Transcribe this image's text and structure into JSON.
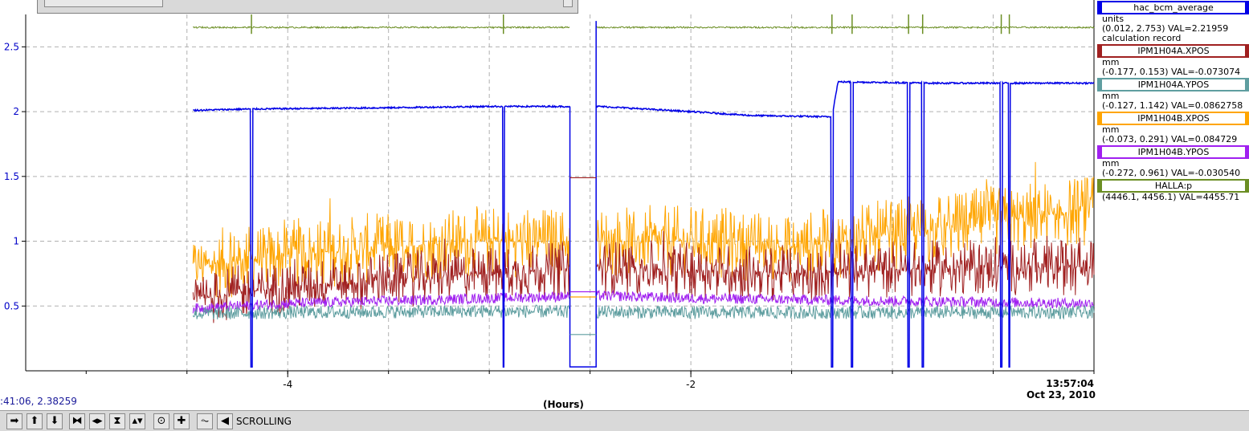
{
  "chart_data": {
    "type": "line",
    "title": "",
    "xlabel": "(Hours)",
    "ylabel": "",
    "xlim": [
      -5.3,
      0.0
    ],
    "ylim": [
      0.0,
      2.75
    ],
    "x_ticks": [
      -4,
      -2
    ],
    "x_tick_labels": [
      "-4",
      "-2"
    ],
    "y_ticks": [
      0.5,
      1,
      1.5,
      2,
      2.5
    ],
    "y_tick_labels": [
      "0.5",
      "1",
      "1.5",
      "2",
      "2.5"
    ],
    "grid": true,
    "legend_position": "right",
    "end_time": "13:57:04",
    "end_date": "Oct 23, 2010",
    "series": [
      {
        "name": "hac_bcm_average",
        "units": "units",
        "range": "(0.012, 2.753)",
        "value": "VAL=2.21959",
        "extra": "calculation record",
        "color": "#0000e6",
        "profile": [
          [
            -4.47,
            2.01
          ],
          [
            -4.2,
            2.02
          ],
          [
            -3.5,
            2.03
          ],
          [
            -3.0,
            2.04
          ],
          [
            -2.9,
            2.04
          ],
          [
            -2.45,
            2.04
          ],
          [
            -2.0,
            2.0
          ],
          [
            -1.7,
            1.97
          ],
          [
            -1.3,
            1.96
          ],
          [
            -1.27,
            2.23
          ],
          [
            -0.8,
            2.22
          ],
          [
            -0.3,
            2.22
          ],
          [
            0.0,
            2.22
          ]
        ]
      },
      {
        "name": "IPM1H04A.XPOS",
        "units": "mm",
        "range": "(-0.177, 0.153)",
        "value": "VAL=-0.073074",
        "color": "#a02020",
        "profile": [
          [
            -4.47,
            0.55
          ],
          [
            -4.0,
            0.65
          ],
          [
            -3.5,
            0.7
          ],
          [
            -3.0,
            0.75
          ],
          [
            -2.45,
            0.8
          ],
          [
            -2.0,
            0.78
          ],
          [
            -1.5,
            0.75
          ],
          [
            -1.0,
            0.78
          ],
          [
            -0.5,
            0.8
          ],
          [
            0.0,
            0.8
          ]
        ]
      },
      {
        "name": "IPM1H04A.YPOS",
        "units": "mm",
        "range": "(-0.127, 1.142)",
        "value": "VAL=0.0862758",
        "color": "#5f9ea0",
        "profile": [
          [
            -4.47,
            0.44
          ],
          [
            -4.0,
            0.45
          ],
          [
            -3.0,
            0.46
          ],
          [
            -2.0,
            0.45
          ],
          [
            -1.0,
            0.45
          ],
          [
            0.0,
            0.45
          ]
        ]
      },
      {
        "name": "IPM1H04B.XPOS",
        "units": "mm",
        "range": "(-0.073, 0.291)",
        "value": "VAL=0.084729",
        "color": "#ffa500",
        "profile": [
          [
            -4.47,
            0.8
          ],
          [
            -4.0,
            0.9
          ],
          [
            -3.5,
            0.95
          ],
          [
            -3.0,
            1.0
          ],
          [
            -2.45,
            1.0
          ],
          [
            -2.0,
            1.0
          ],
          [
            -1.5,
            0.95
          ],
          [
            -1.0,
            1.05
          ],
          [
            -0.5,
            1.15
          ],
          [
            0.0,
            1.25
          ]
        ]
      },
      {
        "name": "IPM1H04B.YPOS",
        "units": "mm",
        "range": "(-0.272, 0.961)",
        "value": "VAL=-0.030540",
        "color": "#a020f0",
        "profile": [
          [
            -4.47,
            0.48
          ],
          [
            -4.0,
            0.52
          ],
          [
            -3.0,
            0.56
          ],
          [
            -2.45,
            0.58
          ],
          [
            -2.0,
            0.56
          ],
          [
            -1.5,
            0.55
          ],
          [
            -1.0,
            0.54
          ],
          [
            -0.5,
            0.53
          ],
          [
            0.0,
            0.52
          ]
        ]
      },
      {
        "name": "HALLA:p",
        "units": "",
        "range": "(4446.1, 4456.1)",
        "value": "VAL=4455.71",
        "color": "#6b8e23",
        "profile": [
          [
            -4.47,
            2.65
          ],
          [
            0.0,
            2.65
          ]
        ]
      }
    ],
    "gap": [
      -2.6,
      -2.47
    ],
    "dropouts": [
      -4.18,
      -2.93,
      -1.3,
      -1.2,
      -0.92,
      -0.85,
      -0.46,
      -0.42
    ]
  },
  "cursor_readout": ":41:06, 2.38259",
  "toolbar": {
    "status_label": "SCROLLING",
    "buttons": [
      {
        "name": "scroll-right-icon",
        "glyph": "➡"
      },
      {
        "name": "scroll-up-icon",
        "glyph": "⬆"
      },
      {
        "name": "scroll-down-icon",
        "glyph": "⬇"
      },
      {
        "name": "zoom-in-x-icon",
        "glyph": "⧓"
      },
      {
        "name": "zoom-out-x-icon",
        "glyph": "◂▸"
      },
      {
        "name": "zoom-in-y-icon",
        "glyph": "⧗"
      },
      {
        "name": "zoom-out-y-icon",
        "glyph": "▴▾"
      },
      {
        "name": "reset-icon",
        "glyph": "⊙"
      },
      {
        "name": "add-icon",
        "glyph": "✚"
      },
      {
        "name": "auto-scale-icon",
        "glyph": "⏦"
      },
      {
        "name": "back-icon",
        "glyph": "◀"
      }
    ]
  }
}
